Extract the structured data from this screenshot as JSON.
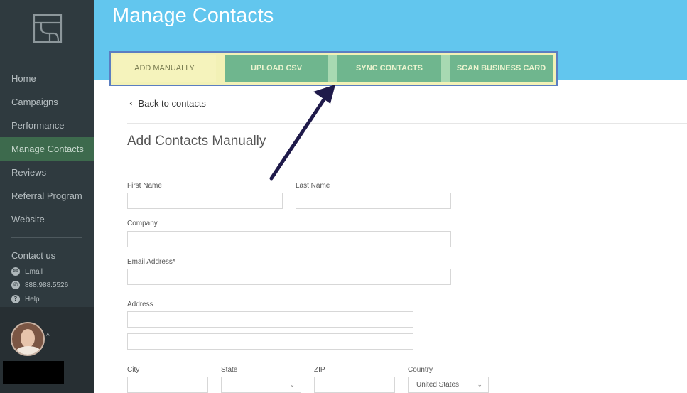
{
  "sidebar": {
    "nav": [
      "Home",
      "Campaigns",
      "Performance",
      "Manage Contacts",
      "Reviews",
      "Referral Program",
      "Website"
    ],
    "active_index": 3,
    "contact_title": "Contact us",
    "contact_email": "Email",
    "contact_phone": "888.988.5526",
    "contact_help": "Help"
  },
  "header": {
    "title": "Manage Contacts",
    "tabs": [
      "ADD MANUALLY",
      "UPLOAD CSV",
      "SYNC CONTACTS",
      "SCAN BUSINESS CARD"
    ],
    "active_tab": 0
  },
  "content": {
    "back_link": "Back to contacts",
    "section_title": "Add Contacts Manually",
    "labels": {
      "first_name": "First Name",
      "last_name": "Last Name",
      "company": "Company",
      "email": "Email Address*",
      "address": "Address",
      "city": "City",
      "state": "State",
      "zip": "ZIP",
      "country": "Country"
    },
    "country_value": "United States"
  },
  "colors": {
    "sidebar_bg": "#2f3a3f",
    "header_bg": "#62c6ee",
    "tab_bg": "#6fb68e",
    "tab_active_bg": "#f5f3bc",
    "arrow": "#1f1a4a"
  }
}
